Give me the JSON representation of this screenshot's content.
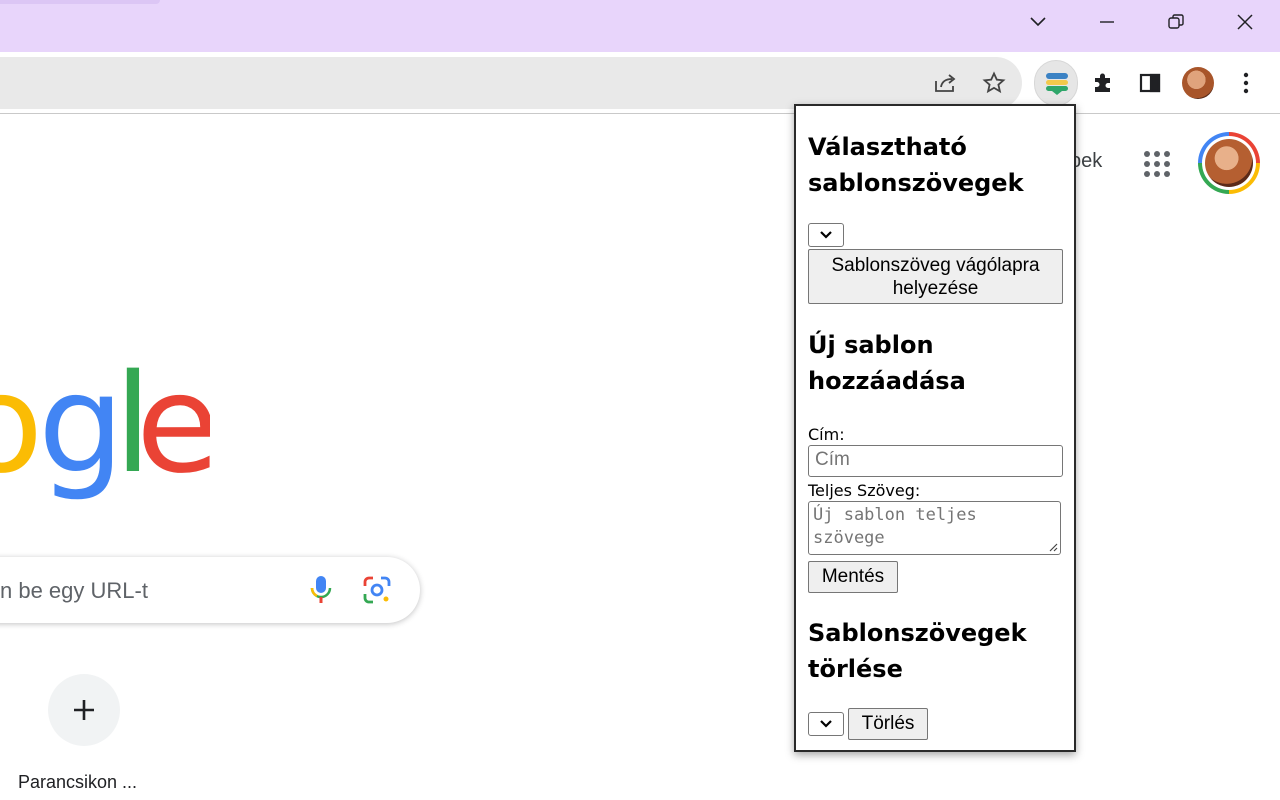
{
  "browser": {
    "window_controls": {
      "dropdown": "chevron-down",
      "minimize": "minimize",
      "restore": "restore",
      "close": "close"
    },
    "toolbar_icons": [
      "share-icon",
      "star-icon",
      "extension-stack-icon",
      "puzzle-icon",
      "side-panel-icon",
      "profile-avatar",
      "more-menu-icon"
    ]
  },
  "page": {
    "header_partial_text": "pek",
    "logo_partial": [
      "o",
      "g",
      "l",
      "e"
    ],
    "logo_colors": {
      "o": "#fbbc04",
      "g": "#4285f4",
      "l": "#34a853",
      "e": "#ea4335"
    },
    "search_partial_placeholder": "n be egy URL-t",
    "shortcut_add_symbol": "+",
    "shortcut_label": "Parancsikon ..."
  },
  "popup": {
    "section1_title": "Választható sablonszövegek",
    "copy_button": "Sablonszöveg vágólapra helyezése",
    "section2_title": "Új sablon hozzáadása",
    "title_label": "Cím:",
    "title_placeholder": "Cím",
    "text_label": "Teljes Szöveg:",
    "text_placeholder": "Új sablon teljes szövege",
    "save_button": "Mentés",
    "section3_title": "Sablonszövegek törlése",
    "delete_button": "Törlés"
  }
}
